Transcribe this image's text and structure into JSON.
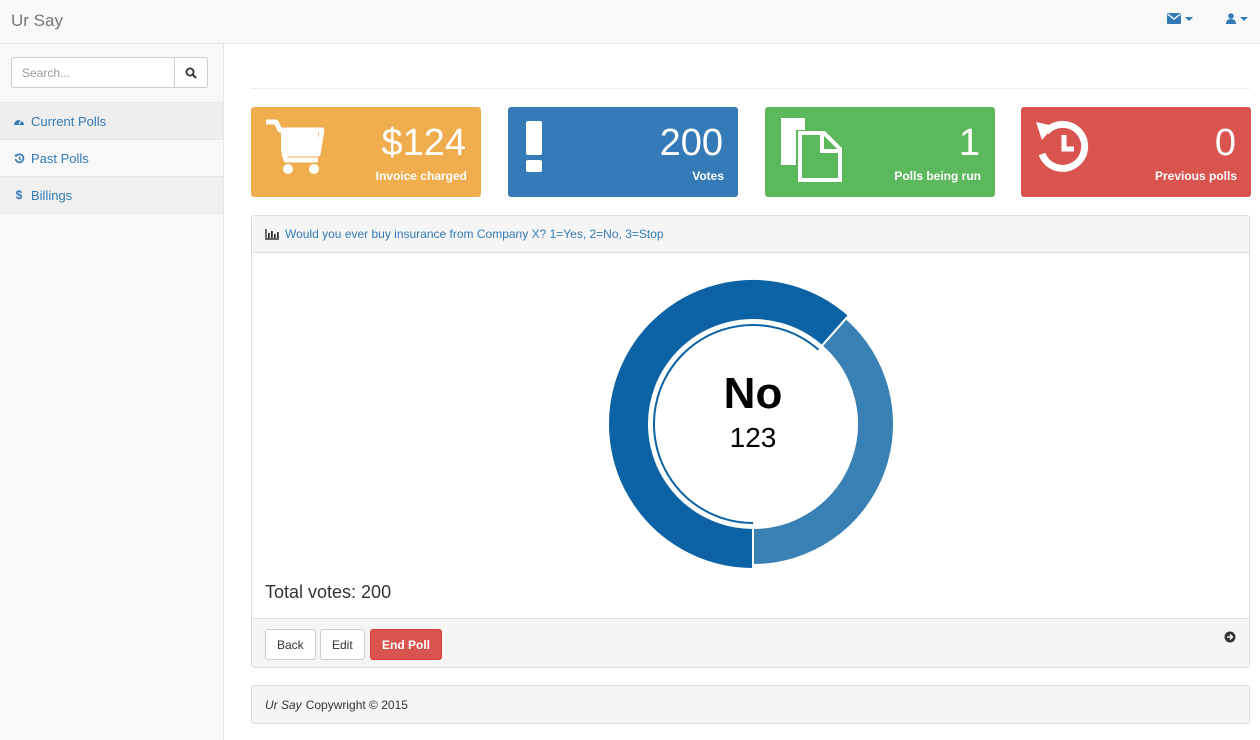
{
  "navbar": {
    "brand": "Ur Say",
    "icons": [
      "envelope-icon",
      "user-icon"
    ]
  },
  "sidebar": {
    "search": {
      "placeholder": "Search...",
      "value": ""
    },
    "items": [
      {
        "label": "Current Polls",
        "icon": "dashboard-icon"
      },
      {
        "label": "Past Polls",
        "icon": "history-icon"
      },
      {
        "label": "Billings",
        "icon": "dollar-icon"
      }
    ]
  },
  "stats": [
    {
      "value": "$124",
      "label": "Invoice charged",
      "color": "#f0ad4e",
      "icon": "cart-icon"
    },
    {
      "value": "200",
      "label": "Votes",
      "color": "#337ab7",
      "icon": "exclamation-icon"
    },
    {
      "value": "1",
      "label": "Polls being run",
      "color": "#5cb85c",
      "icon": "files-icon"
    },
    {
      "value": "0",
      "label": "Previous polls",
      "color": "#d9534f",
      "icon": "history-icon"
    }
  ],
  "poll": {
    "question": "Would you ever buy insurance from Company X? 1=Yes, 2=No, 3=Stop",
    "total": "Total votes: 200",
    "buttons": {
      "back": "Back",
      "edit": "Edit",
      "end": "End Poll"
    }
  },
  "chart_data": {
    "type": "pie",
    "donut": true,
    "total": 200,
    "center_label": "No",
    "center_value": "123",
    "slices": [
      {
        "label": "No",
        "value": 123,
        "color": "#0b62a4",
        "highlighted": true
      },
      {
        "label": "",
        "value": 77,
        "color": "#3980b5"
      }
    ]
  },
  "footer": {
    "brand": "Ur Say",
    "text": "Copywright © 2015"
  }
}
